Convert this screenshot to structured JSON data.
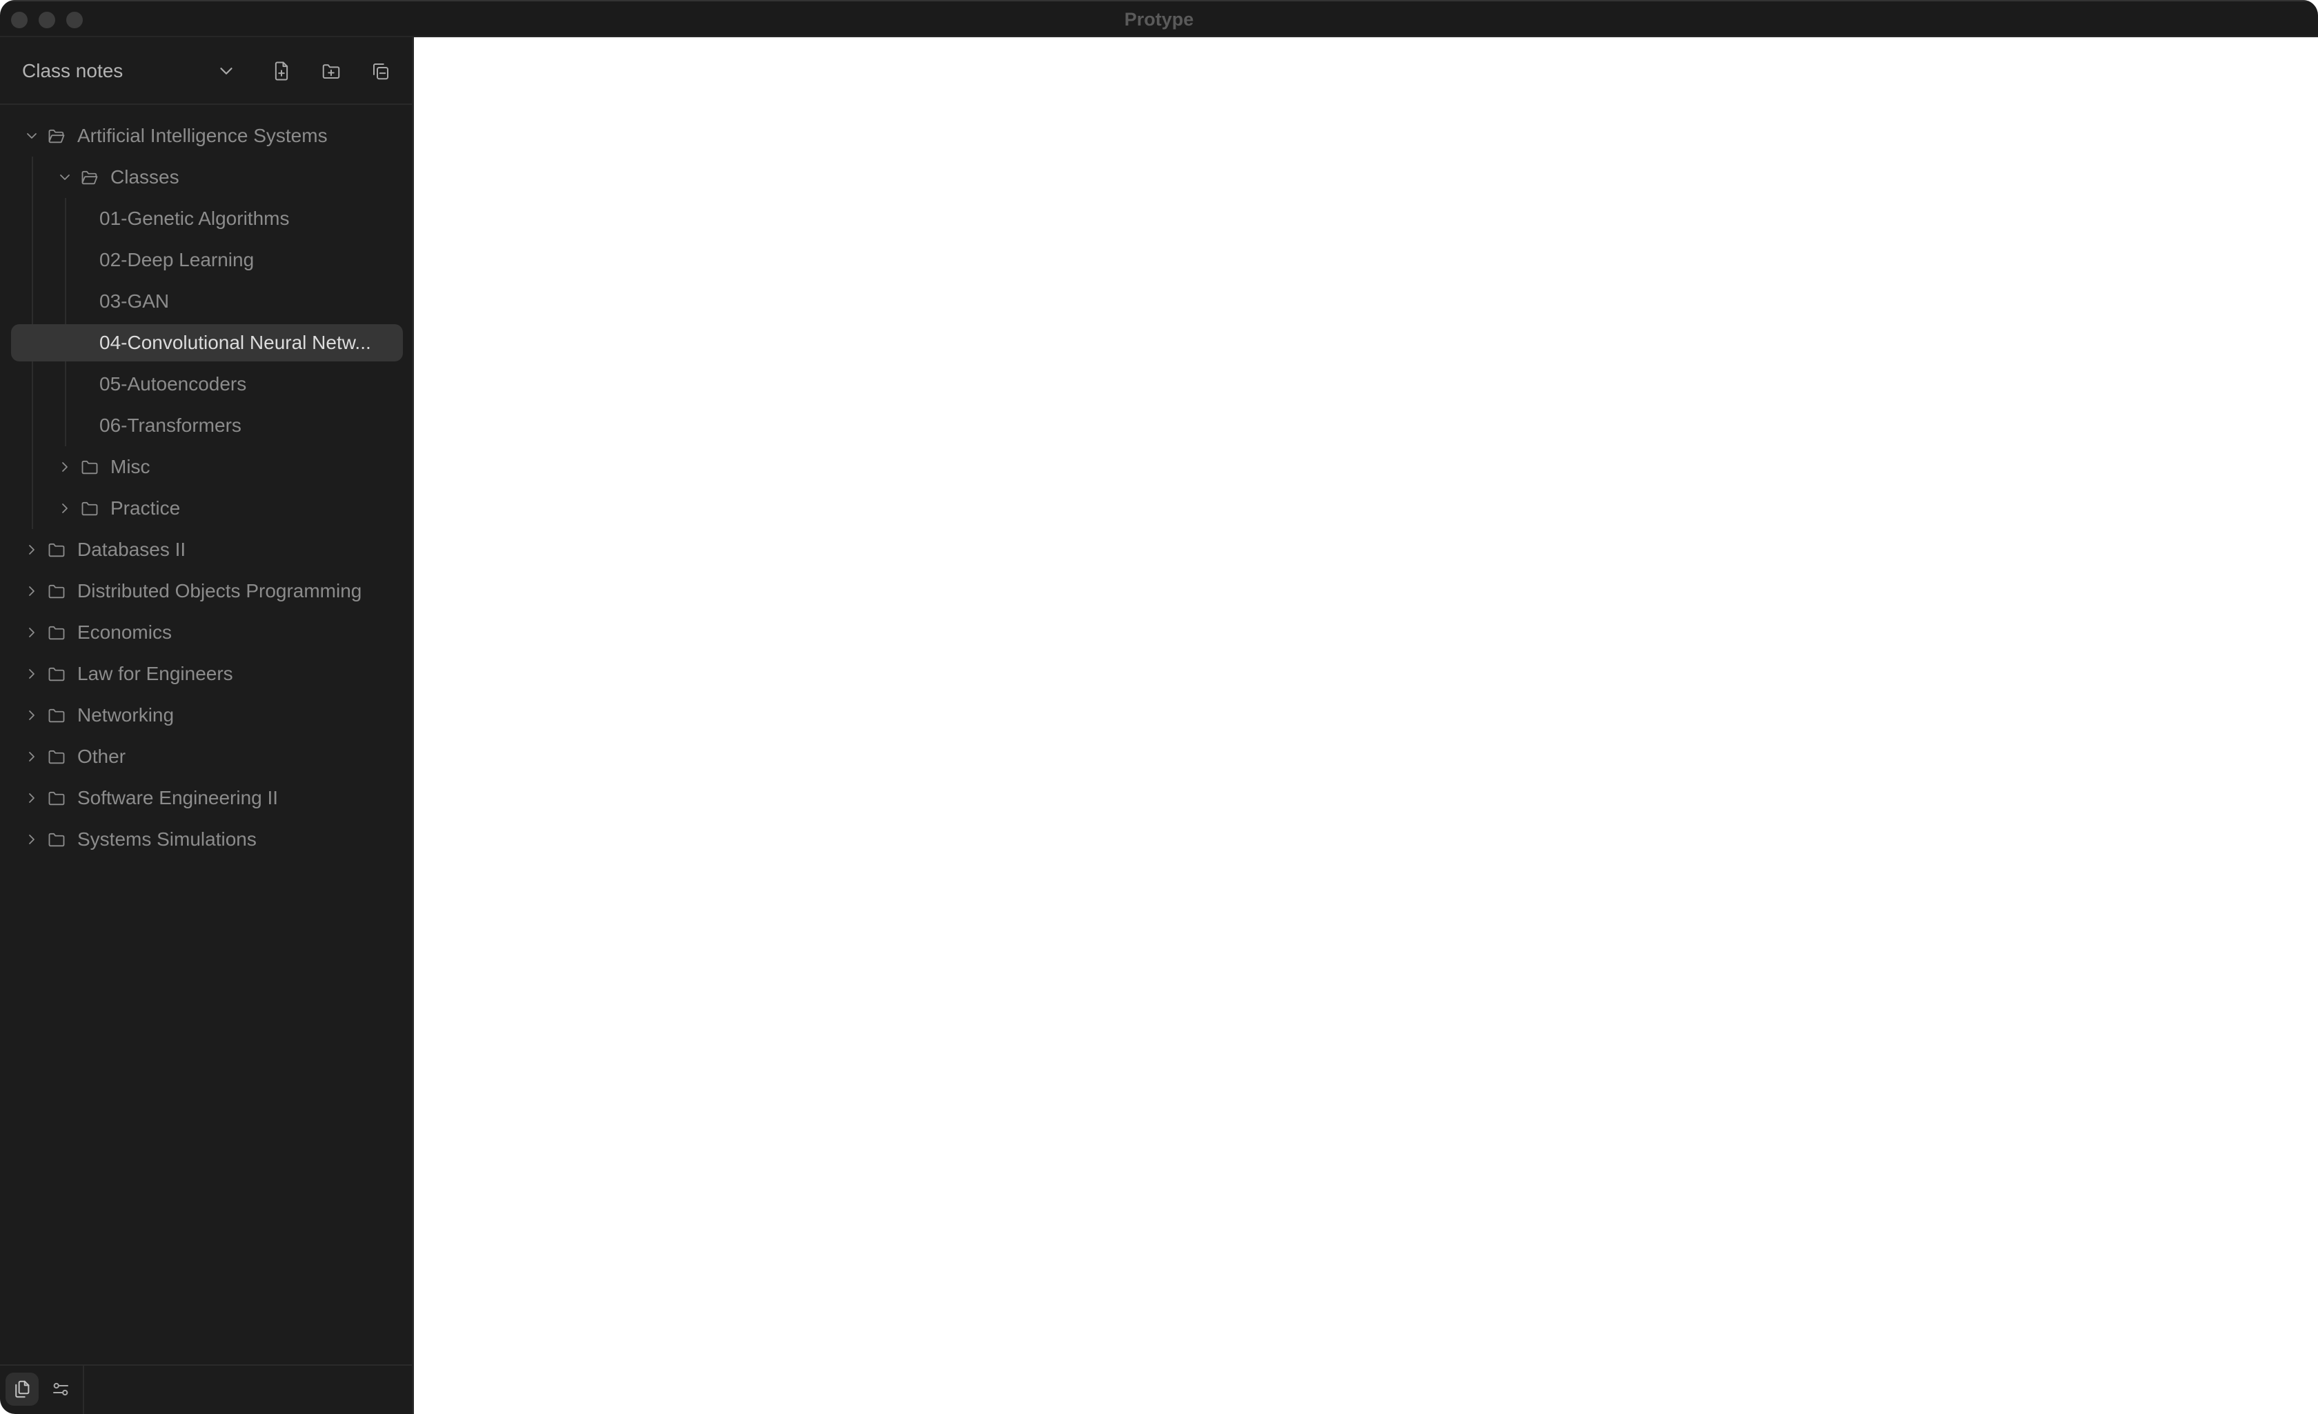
{
  "window": {
    "title": "Protype",
    "traffic_lights": [
      "close",
      "minimize",
      "zoom"
    ]
  },
  "sidebar": {
    "vault_name": "Class notes",
    "header_icons": {
      "vault_menu": "chevron-down-icon",
      "new_note": "file-plus-icon",
      "new_folder": "folder-plus-icon",
      "collapse_all": "collapse-all-icon"
    },
    "tree": [
      {
        "label": "Artificial Intelligence Systems",
        "type": "folder",
        "depth": 0,
        "expanded": true
      },
      {
        "label": "Classes",
        "type": "folder",
        "depth": 1,
        "expanded": true
      },
      {
        "label": "01-Genetic Algorithms",
        "type": "note",
        "depth": 2
      },
      {
        "label": "02-Deep Learning",
        "type": "note",
        "depth": 2
      },
      {
        "label": "03-GAN",
        "type": "note",
        "depth": 2
      },
      {
        "label": "04-Convolutional Neural Netw...",
        "type": "note",
        "depth": 2,
        "selected": true
      },
      {
        "label": "05-Autoencoders",
        "type": "note",
        "depth": 2
      },
      {
        "label": "06-Transformers",
        "type": "note",
        "depth": 2
      },
      {
        "label": "Misc",
        "type": "folder",
        "depth": 1,
        "expanded": false
      },
      {
        "label": "Practice",
        "type": "folder",
        "depth": 1,
        "expanded": false
      },
      {
        "label": "Databases II",
        "type": "folder",
        "depth": 0,
        "expanded": false
      },
      {
        "label": "Distributed Objects Programming",
        "type": "folder",
        "depth": 0,
        "expanded": false
      },
      {
        "label": "Economics",
        "type": "folder",
        "depth": 0,
        "expanded": false
      },
      {
        "label": "Law for Engineers",
        "type": "folder",
        "depth": 0,
        "expanded": false
      },
      {
        "label": "Networking",
        "type": "folder",
        "depth": 0,
        "expanded": false
      },
      {
        "label": "Other",
        "type": "folder",
        "depth": 0,
        "expanded": false
      },
      {
        "label": "Software Engineering II",
        "type": "folder",
        "depth": 0,
        "expanded": false
      },
      {
        "label": "Systems Simulations",
        "type": "folder",
        "depth": 0,
        "expanded": false
      }
    ],
    "footer": {
      "files_icon": "files-icon",
      "settings_icon": "sliders-icon",
      "active": "files"
    }
  },
  "colors": {
    "titlebar": "#1b1b1b",
    "sidebar": "#1c1c1c",
    "selected_row": "#363636",
    "text": "#8c8c8c",
    "text_selected": "#dcdcdc",
    "editor": "#ffffff"
  }
}
